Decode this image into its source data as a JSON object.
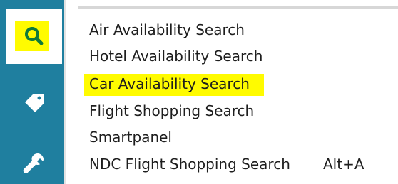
{
  "menu": {
    "items": [
      {
        "label": "Air Availability Search",
        "shortcut": ""
      },
      {
        "label": "Hotel Availability Search",
        "shortcut": ""
      },
      {
        "label": "Car Availability Search",
        "shortcut": "",
        "highlighted": true
      },
      {
        "label": "Flight Shopping Search",
        "shortcut": ""
      },
      {
        "label": "Smartpanel",
        "shortcut": ""
      },
      {
        "label": "NDC Flight Shopping Search",
        "shortcut": "Alt+A"
      }
    ]
  },
  "sidebar": {
    "icons": [
      "search-icon",
      "tag-icon",
      "wrench-icon"
    ],
    "color": "#1f7f9f",
    "active_icon_color": "#0f7a3a",
    "highlight_color": "#fffb00"
  }
}
